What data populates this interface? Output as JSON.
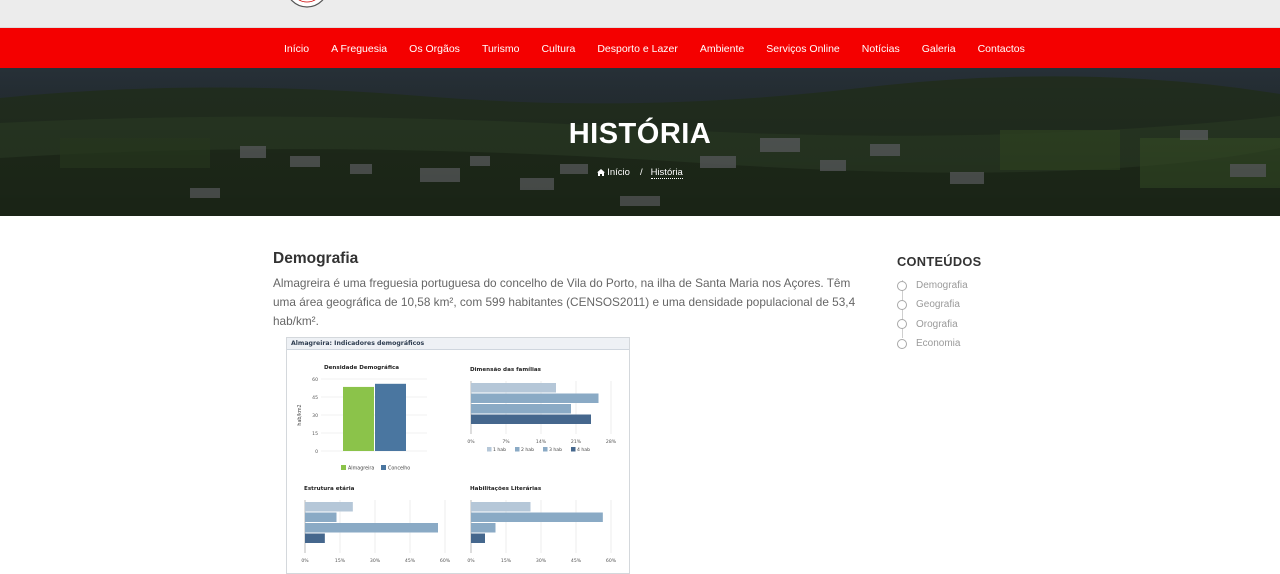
{
  "nav": {
    "items": [
      "Início",
      "A Freguesia",
      "Os Orgãos",
      "Turismo",
      "Cultura",
      "Desporto e Lazer",
      "Ambiente",
      "Serviços Online",
      "Notícias",
      "Galeria",
      "Contactos"
    ]
  },
  "hero": {
    "title": "HISTÓRIA",
    "breadcrumb": {
      "home": "Início",
      "separator": "/",
      "current": "História"
    }
  },
  "main": {
    "section_title": "Demografia",
    "paragraph": "Almagreira é uma freguesia portuguesa do concelho de Vila do Porto, na ilha de Santa Maria nos Açores. Têm uma área geográfica de 10,58 km², com 599 habitantes (CENSOS2011) e uma densidade populacional de 53,4 hab/km²."
  },
  "sidebar": {
    "title": "CONTEÚDOS",
    "items": [
      "Demografia",
      "Geografia",
      "Orografia",
      "Economia"
    ]
  },
  "colors": {
    "nav_red": "#f40000",
    "chart_green": "#8bc34a",
    "chart_blue": "#4a76a0",
    "bar_pale": "#b5c7d8",
    "bar_mid": "#8aaac5",
    "bar_dark": "#45678d"
  },
  "icons": {
    "breadcrumb_home": "home-icon"
  },
  "figure": {
    "header": "Almagreira: Indicadores demográficos"
  },
  "chart_data": [
    {
      "type": "bar",
      "title": "Densidade Demográfica",
      "ylabel": "hab/km2",
      "ylim": [
        0,
        60
      ],
      "yticks": [
        "0",
        "15",
        "30",
        "45",
        "60"
      ],
      "series": [
        {
          "name": "Almagreira",
          "values": [
            53.4
          ]
        },
        {
          "name": "Concelho",
          "values": [
            56
          ]
        }
      ]
    },
    {
      "type": "bar",
      "orientation": "horizontal",
      "title": "Dimensão das famílias",
      "xlim": [
        0,
        28
      ],
      "xticks": [
        "0%",
        "7%",
        "14%",
        "21%",
        "28%"
      ],
      "categories": [
        "1 hab",
        "2 hab",
        "3 hab",
        "4 hab"
      ],
      "values": [
        17,
        25.5,
        20,
        24
      ],
      "legend": [
        "1 hab",
        "2 hab",
        "3 hab",
        "4 hab"
      ]
    },
    {
      "type": "bar",
      "orientation": "horizontal",
      "title": "Estrutura etária",
      "xlim": [
        0,
        60
      ],
      "xticks": [
        "0%",
        "15%",
        "30%",
        "45%",
        "60%"
      ],
      "values": [
        20.5,
        13.5,
        57,
        8.5
      ]
    },
    {
      "type": "bar",
      "orientation": "horizontal",
      "title": "Habilitações Literárias",
      "xlim": [
        0,
        60
      ],
      "xticks": [
        "0%",
        "15%",
        "30%",
        "45%",
        "60%"
      ],
      "values": [
        25.5,
        56.5,
        10.5,
        6
      ]
    }
  ]
}
